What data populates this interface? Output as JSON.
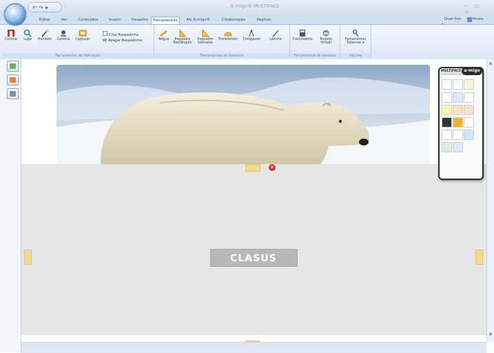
{
  "window": {
    "title": "A-migo® MULTIFACE",
    "controls": "– ▭ ×"
  },
  "quick_access": "↶ ↷ ▾",
  "tabs": [
    {
      "label": "Editar"
    },
    {
      "label": "Ver"
    },
    {
      "label": "Conteúdos"
    },
    {
      "label": "Inserir"
    },
    {
      "label": "Desenho"
    },
    {
      "label": "Ferramentas",
      "active": true
    },
    {
      "label": "My A-migo®"
    },
    {
      "label": "Colaboração"
    },
    {
      "label": "Páginas"
    }
  ],
  "right_tabs": {
    "dual_pen": "Dual Pen",
    "ponto": "Ponto"
  },
  "ribbon": {
    "app_group": {
      "label": "Ferramentas de Aplicação",
      "buttons": [
        "Cortina",
        "Lupa",
        "Holofote",
        "Camera",
        "Capturar"
      ],
      "side": [
        "Criar Raspadinha",
        "Apagar Raspadinha"
      ]
    },
    "draw_group": {
      "label": "Ferramentas de Desenho",
      "buttons": [
        "Régua",
        "Esquadro Rectângulo",
        "Esquadro Isósceles",
        "Transferidor",
        "Compasso",
        "Lâmina"
      ]
    },
    "system_group": {
      "label": "Ferramentas do sistema",
      "buttons": [
        "Calculadora",
        "Teclado Virtual"
      ]
    },
    "options_group": {
      "label": "Opções",
      "buttons": [
        "Ferramentas Externas ▾"
      ]
    }
  },
  "canvas": {
    "logo_text": "CLASUS",
    "close_glyph": "✕"
  },
  "float_toolbar": {
    "title": "MULTIFACE",
    "brand": "a-migo"
  },
  "colors": {
    "accent": "#2e4d78",
    "shade": "#e6e6e6",
    "handle": "#f2d98c",
    "close": "#d9342b"
  }
}
